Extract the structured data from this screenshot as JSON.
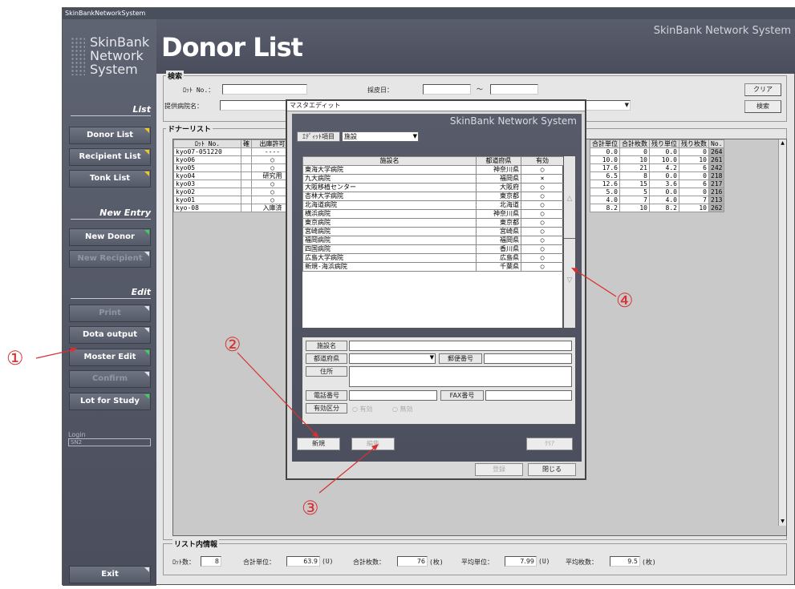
{
  "window_title": "SkinBankNetworkSystem",
  "logo": {
    "lines": [
      "SkinBank",
      "Network",
      "System"
    ]
  },
  "header": {
    "title": "Donor List",
    "brand": "SkinBank Network System"
  },
  "sidebar": {
    "sections": {
      "list": "List",
      "new_entry": "New Entry",
      "edit": "Edit"
    },
    "buttons": {
      "donor_list": "Donor List",
      "recipient_list": "Recipient List",
      "tonk_list": "Tonk List",
      "new_donor": "New Donor",
      "new_recipient": "New Recipient",
      "print": "Print",
      "data_output": "Dota output",
      "master_edit": "Moster Edit",
      "confirm": "Confirm",
      "lot_for_study": "Lot for Study",
      "exit": "Exit"
    },
    "login_label": "Login",
    "login_value": "SN2"
  },
  "search": {
    "title": "検索",
    "lot_no_label": "ﾛｯﾄ No.：",
    "date_label": "採皮日：",
    "range_sep": "〜",
    "hospital_label": "提供病院名：",
    "clear_button": "クリア",
    "search_button": "検索"
  },
  "donor_list": {
    "title": "ドナーリスト",
    "left_columns": [
      "ﾛｯﾄ No.",
      "確",
      "出庫許可"
    ],
    "left_rows": [
      [
        "kyo07-051220",
        "",
        "----"
      ],
      [
        "kyo06",
        "",
        "○"
      ],
      [
        "kyo05",
        "",
        "○"
      ],
      [
        "kyo04",
        "",
        "研究用"
      ],
      [
        "kyo03",
        "",
        "○"
      ],
      [
        "kyo02",
        "",
        "○"
      ],
      [
        "kyo01",
        "",
        "○"
      ],
      [
        "kyo-08",
        "",
        "入庫済"
      ]
    ],
    "right_columns": [
      "合計単位",
      "合計枚数",
      "残り単位",
      "残り枚数",
      "No."
    ],
    "right_rows": [
      [
        "0.0",
        "0",
        "0.0",
        "0",
        "264"
      ],
      [
        "10.0",
        "10",
        "10.0",
        "10",
        "261"
      ],
      [
        "17.6",
        "21",
        "4.2",
        "6",
        "242"
      ],
      [
        "6.5",
        "8",
        "0.0",
        "0",
        "218"
      ],
      [
        "12.6",
        "15",
        "3.6",
        "6",
        "217"
      ],
      [
        "5.0",
        "5",
        "0.0",
        "0",
        "216"
      ],
      [
        "4.0",
        "7",
        "4.0",
        "7",
        "213"
      ],
      [
        "8.2",
        "10",
        "8.2",
        "10",
        "262"
      ]
    ]
  },
  "list_info": {
    "title": "リスト内情報",
    "lot_count_label": "ﾛｯﾄ数：",
    "lot_count": "8",
    "total_units_label": "合計単位：",
    "total_units": "63.9",
    "total_units_unit": "(U)",
    "total_count_label": "合計枚数：",
    "total_count": "76",
    "total_count_unit": "(枚)",
    "avg_units_label": "平均単位：",
    "avg_units": "7.99",
    "avg_units_unit": "(U)",
    "avg_count_label": "平均枚数：",
    "avg_count": "9.5",
    "avg_count_unit": "(枚)"
  },
  "dialog": {
    "title": "マスタエディット",
    "brand": "SkinBank Network System",
    "edit_item_label": "ｴﾃﾞｨｯﾄ項目",
    "edit_item_value": "施設",
    "columns": [
      "施設名",
      "都道府県",
      "有効"
    ],
    "rows": [
      [
        "東海大学病院",
        "神奈川県",
        "○"
      ],
      [
        "九大病院",
        "福岡県",
        "×"
      ],
      [
        "大阪移植センター",
        "大阪府",
        "○"
      ],
      [
        "杏林大学病院",
        "東京都",
        "○"
      ],
      [
        "北海道病院",
        "北海道",
        "○"
      ],
      [
        "横浜病院",
        "神奈川県",
        "○"
      ],
      [
        "東京病院",
        "東京都",
        "○"
      ],
      [
        "宮崎病院",
        "宮崎県",
        "○"
      ],
      [
        "福岡病院",
        "福岡県",
        "○"
      ],
      [
        "四国病院",
        "香川県",
        "○"
      ],
      [
        "広島大学病院",
        "広島県",
        "○"
      ],
      [
        "新規-海浜病院",
        "千葉県",
        "○"
      ]
    ],
    "scroll_up": "△",
    "scroll_down": "▽",
    "form": {
      "facility_name": "施設名",
      "prefecture": "都道府県",
      "postal_code": "郵便番号",
      "address": "住所",
      "phone": "電話番号",
      "fax": "FAX番号",
      "valid_class": "有効区分",
      "valid_option": "有効",
      "invalid_option": "無効"
    },
    "buttons": {
      "new": "新規",
      "edit": "編集",
      "clear": "ｸﾘｱ",
      "register": "登録",
      "close": "閉じる"
    }
  },
  "annotations": {
    "c1": "①",
    "c2": "②",
    "c3": "③",
    "c4": "④"
  },
  "colors": {
    "accent_yellow": "#f0c81e",
    "accent_green": "#3cd05a",
    "annotation_red": "#d83030"
  }
}
